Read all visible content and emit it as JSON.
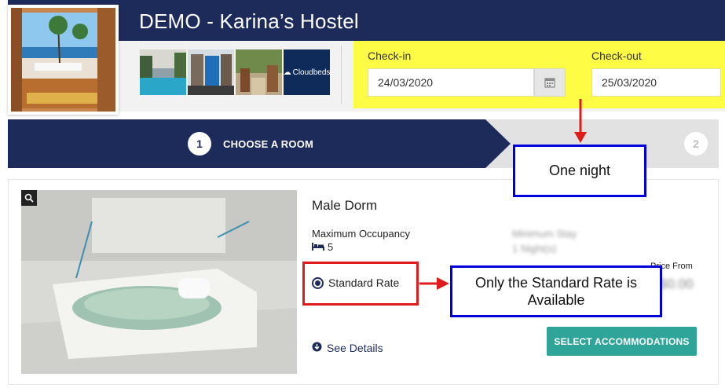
{
  "header": {
    "title": "DEMO - Karina’s Hostel"
  },
  "gallery": {
    "thumbnails": [
      "pool-photo",
      "lounge-photo",
      "garden-photo"
    ],
    "brand_text": "Cloudbeds"
  },
  "dates": {
    "checkin_label": "Check-in",
    "checkin_value": "24/03/2020",
    "checkout_label": "Check-out",
    "checkout_value": "25/03/2020"
  },
  "steps": [
    {
      "number": "1",
      "label": "CHOOSE A ROOM",
      "active": true
    },
    {
      "number": "2",
      "label": "",
      "active": false
    }
  ],
  "room": {
    "name": "Male Dorm",
    "max_occupancy_label": "Maximum Occupancy",
    "max_occupancy_value": "5",
    "min_stay_label": "Minimum Stay",
    "min_stay_value": "1 Night(s)",
    "price_from_label": "Price From",
    "price_value": "$0.00",
    "rate_option": "Standard Rate",
    "see_details": "See Details",
    "select_button": "SELECT ACCOMMODATIONS"
  },
  "annotations": {
    "one_night": "One night",
    "only_standard": "Only the Standard Rate is Available"
  },
  "colors": {
    "navy": "#1d2b5a",
    "highlight_yellow": "#fffc45",
    "teal_button": "#2fa59a",
    "callout_blue": "#0000dd",
    "callout_red": "#e01b1b"
  }
}
